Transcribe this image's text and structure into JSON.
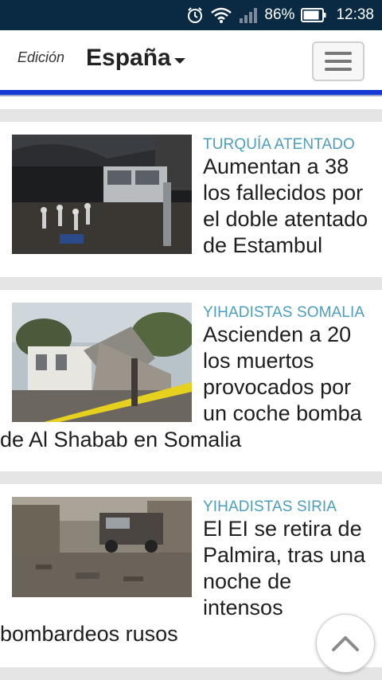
{
  "status_bar": {
    "battery_percent": "86%",
    "time": "12:38",
    "icons": [
      "alarm-icon",
      "wifi-icon",
      "signal-icon",
      "battery-icon"
    ]
  },
  "header": {
    "edition_label": "Edición",
    "edition_value": "España",
    "menu_icon": "hamburger-icon",
    "accent_color": "#1238d6"
  },
  "articles": [
    {
      "category": "TURQUÍA ATENTADO",
      "headline": "Aumentan a 38 los fallecidos por el doble atentado de Estambul"
    },
    {
      "category": "YIHADISTAS SOMALIA",
      "headline": "Ascienden a 20 los muertos provocados por un coche bomba de Al Shabab en Somalia"
    },
    {
      "category": "YIHADISTAS SIRIA",
      "headline": "El EI se retira de Palmira, tras una noche de intensos bombardeos rusos"
    }
  ],
  "colors": {
    "category": "#4a9fbd",
    "status_bar": "#0a2a44",
    "separator": "#e5e5e5"
  },
  "scroll_top_icon": "chevron-up-icon"
}
